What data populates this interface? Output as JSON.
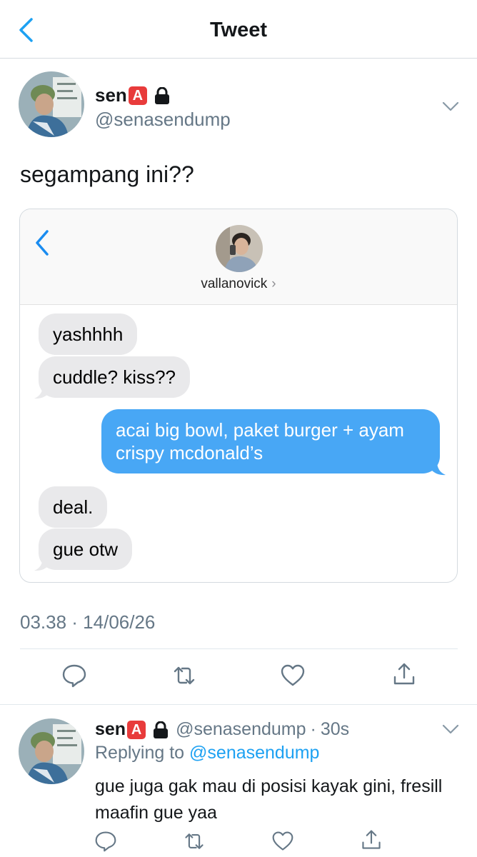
{
  "header": {
    "title": "Tweet"
  },
  "tweet": {
    "display_name": "sen",
    "badge": "A",
    "handle": "@senasendump",
    "text": "segampang ini??",
    "timestamp": "03.38 · 14/06/26"
  },
  "screenshot_card": {
    "contact_name": "vallanovick",
    "contact_chevron": "›",
    "messages": [
      {
        "from": "them",
        "text": "yashhhh"
      },
      {
        "from": "them",
        "text": "cuddle? kiss??"
      },
      {
        "from": "me",
        "text": "acai big bowl, paket burger + ayam crispy mcdonald’s"
      },
      {
        "from": "them",
        "text": "deal."
      },
      {
        "from": "them",
        "text": "gue otw"
      }
    ],
    "colors": {
      "incoming": "#e9e9eb",
      "outgoing": "#48a7f5"
    }
  },
  "actions": {
    "icons": [
      "reply-icon",
      "retweet-icon",
      "like-icon",
      "share-icon"
    ]
  },
  "reply": {
    "display_name": "sen",
    "badge": "A",
    "handle": "@senasendump",
    "dot": "·",
    "time": "30s",
    "replying_prefix": "Replying to",
    "replying_handle": "@senasendump",
    "text": "gue juga gak mau di posisi kayak gini, fresill maafin gue yaa"
  },
  "colors": {
    "accent": "#1da1f2",
    "muted": "#657786",
    "badge": "#e83b3b"
  }
}
